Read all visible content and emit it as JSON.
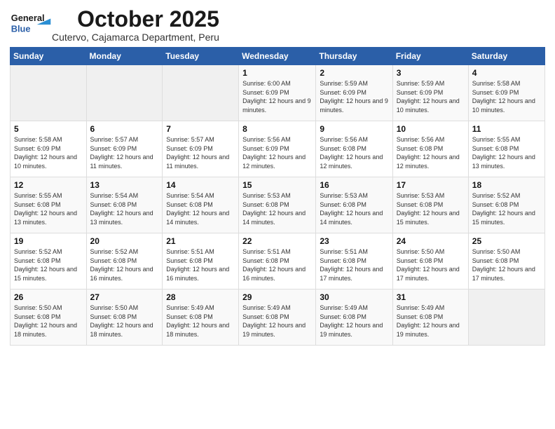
{
  "header": {
    "logo_line1": "General",
    "logo_line2": "Blue",
    "month": "October 2025",
    "location": "Cutervo, Cajamarca Department, Peru"
  },
  "days_of_week": [
    "Sunday",
    "Monday",
    "Tuesday",
    "Wednesday",
    "Thursday",
    "Friday",
    "Saturday"
  ],
  "weeks": [
    [
      {
        "day": "",
        "info": ""
      },
      {
        "day": "",
        "info": ""
      },
      {
        "day": "",
        "info": ""
      },
      {
        "day": "1",
        "info": "Sunrise: 6:00 AM\nSunset: 6:09 PM\nDaylight: 12 hours\nand 9 minutes."
      },
      {
        "day": "2",
        "info": "Sunrise: 5:59 AM\nSunset: 6:09 PM\nDaylight: 12 hours\nand 9 minutes."
      },
      {
        "day": "3",
        "info": "Sunrise: 5:59 AM\nSunset: 6:09 PM\nDaylight: 12 hours\nand 10 minutes."
      },
      {
        "day": "4",
        "info": "Sunrise: 5:58 AM\nSunset: 6:09 PM\nDaylight: 12 hours\nand 10 minutes."
      }
    ],
    [
      {
        "day": "5",
        "info": "Sunrise: 5:58 AM\nSunset: 6:09 PM\nDaylight: 12 hours\nand 10 minutes."
      },
      {
        "day": "6",
        "info": "Sunrise: 5:57 AM\nSunset: 6:09 PM\nDaylight: 12 hours\nand 11 minutes."
      },
      {
        "day": "7",
        "info": "Sunrise: 5:57 AM\nSunset: 6:09 PM\nDaylight: 12 hours\nand 11 minutes."
      },
      {
        "day": "8",
        "info": "Sunrise: 5:56 AM\nSunset: 6:09 PM\nDaylight: 12 hours\nand 12 minutes."
      },
      {
        "day": "9",
        "info": "Sunrise: 5:56 AM\nSunset: 6:08 PM\nDaylight: 12 hours\nand 12 minutes."
      },
      {
        "day": "10",
        "info": "Sunrise: 5:56 AM\nSunset: 6:08 PM\nDaylight: 12 hours\nand 12 minutes."
      },
      {
        "day": "11",
        "info": "Sunrise: 5:55 AM\nSunset: 6:08 PM\nDaylight: 12 hours\nand 13 minutes."
      }
    ],
    [
      {
        "day": "12",
        "info": "Sunrise: 5:55 AM\nSunset: 6:08 PM\nDaylight: 12 hours\nand 13 minutes."
      },
      {
        "day": "13",
        "info": "Sunrise: 5:54 AM\nSunset: 6:08 PM\nDaylight: 12 hours\nand 13 minutes."
      },
      {
        "day": "14",
        "info": "Sunrise: 5:54 AM\nSunset: 6:08 PM\nDaylight: 12 hours\nand 14 minutes."
      },
      {
        "day": "15",
        "info": "Sunrise: 5:53 AM\nSunset: 6:08 PM\nDaylight: 12 hours\nand 14 minutes."
      },
      {
        "day": "16",
        "info": "Sunrise: 5:53 AM\nSunset: 6:08 PM\nDaylight: 12 hours\nand 14 minutes."
      },
      {
        "day": "17",
        "info": "Sunrise: 5:53 AM\nSunset: 6:08 PM\nDaylight: 12 hours\nand 15 minutes."
      },
      {
        "day": "18",
        "info": "Sunrise: 5:52 AM\nSunset: 6:08 PM\nDaylight: 12 hours\nand 15 minutes."
      }
    ],
    [
      {
        "day": "19",
        "info": "Sunrise: 5:52 AM\nSunset: 6:08 PM\nDaylight: 12 hours\nand 15 minutes."
      },
      {
        "day": "20",
        "info": "Sunrise: 5:52 AM\nSunset: 6:08 PM\nDaylight: 12 hours\nand 16 minutes."
      },
      {
        "day": "21",
        "info": "Sunrise: 5:51 AM\nSunset: 6:08 PM\nDaylight: 12 hours\nand 16 minutes."
      },
      {
        "day": "22",
        "info": "Sunrise: 5:51 AM\nSunset: 6:08 PM\nDaylight: 12 hours\nand 16 minutes."
      },
      {
        "day": "23",
        "info": "Sunrise: 5:51 AM\nSunset: 6:08 PM\nDaylight: 12 hours\nand 17 minutes."
      },
      {
        "day": "24",
        "info": "Sunrise: 5:50 AM\nSunset: 6:08 PM\nDaylight: 12 hours\nand 17 minutes."
      },
      {
        "day": "25",
        "info": "Sunrise: 5:50 AM\nSunset: 6:08 PM\nDaylight: 12 hours\nand 17 minutes."
      }
    ],
    [
      {
        "day": "26",
        "info": "Sunrise: 5:50 AM\nSunset: 6:08 PM\nDaylight: 12 hours\nand 18 minutes."
      },
      {
        "day": "27",
        "info": "Sunrise: 5:50 AM\nSunset: 6:08 PM\nDaylight: 12 hours\nand 18 minutes."
      },
      {
        "day": "28",
        "info": "Sunrise: 5:49 AM\nSunset: 6:08 PM\nDaylight: 12 hours\nand 18 minutes."
      },
      {
        "day": "29",
        "info": "Sunrise: 5:49 AM\nSunset: 6:08 PM\nDaylight: 12 hours\nand 19 minutes."
      },
      {
        "day": "30",
        "info": "Sunrise: 5:49 AM\nSunset: 6:08 PM\nDaylight: 12 hours\nand 19 minutes."
      },
      {
        "day": "31",
        "info": "Sunrise: 5:49 AM\nSunset: 6:08 PM\nDaylight: 12 hours\nand 19 minutes."
      },
      {
        "day": "",
        "info": ""
      }
    ]
  ]
}
